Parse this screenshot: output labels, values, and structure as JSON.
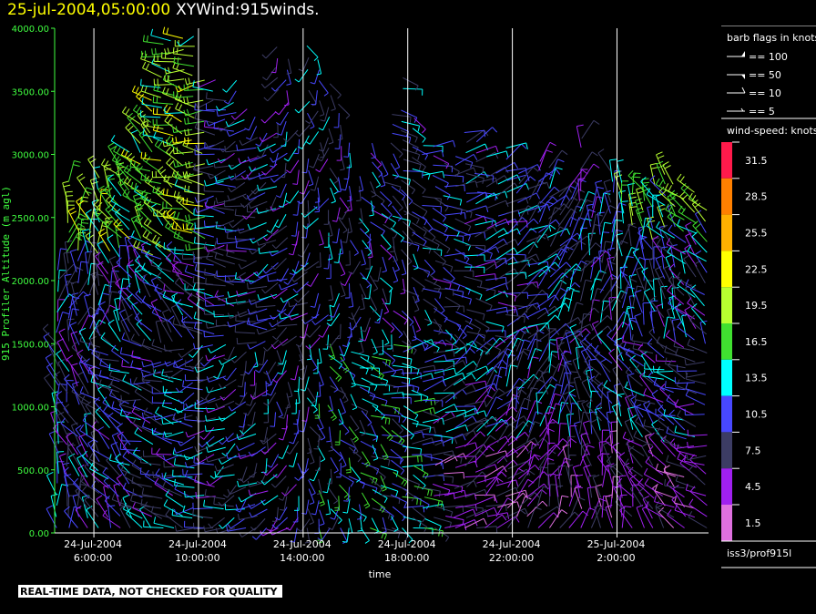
{
  "header": {
    "date": "25-jul-2004,05:00:00",
    "name": "XYWind:915winds."
  },
  "footer": {
    "notice": "REAL-TIME DATA, NOT CHECKED FOR QUALITY",
    "station": "iss3/prof915l"
  },
  "legend": {
    "barb_title": "barb flags in knots",
    "barbs": [
      {
        "label": "== 100",
        "speed": 100
      },
      {
        "label": "== 50",
        "speed": 50
      },
      {
        "label": "== 10",
        "speed": 10
      },
      {
        "label": "== 5",
        "speed": 5
      }
    ],
    "speed_title": "wind-speed: knots",
    "colorbar": [
      {
        "label": "31.5",
        "color": "#ff1a4b"
      },
      {
        "label": "28.5",
        "color": "#ff8000"
      },
      {
        "label": "25.5",
        "color": "#ffb000"
      },
      {
        "label": "22.5",
        "color": "#ffff00"
      },
      {
        "label": "19.5",
        "color": "#b8ff30"
      },
      {
        "label": "16.5",
        "color": "#40e030"
      },
      {
        "label": "13.5",
        "color": "#00ffff"
      },
      {
        "label": "10.5",
        "color": "#4848ff"
      },
      {
        "label": "7.5",
        "color": "#3c3c64"
      },
      {
        "label": "4.5",
        "color": "#a020f0"
      },
      {
        "label": "1.5",
        "color": "#e070e0"
      }
    ]
  },
  "chart_data": {
    "type": "scatter",
    "title": "XYWind:915winds.",
    "xlabel": "time",
    "ylabel": "915 Profiler Altitude (m agl)",
    "xlim_hours": [
      4.5,
      29.5
    ],
    "ylim": [
      0,
      4000
    ],
    "y_ticks": [
      "0.00",
      "500.00",
      "1000.00",
      "1500.00",
      "2000.00",
      "2500.00",
      "3000.00",
      "3500.00",
      "4000.00"
    ],
    "x_ticks": [
      {
        "hour": 6,
        "date": "24-Jul-2004",
        "time": "6:00:00"
      },
      {
        "hour": 10,
        "date": "24-Jul-2004",
        "time": "10:00:00"
      },
      {
        "hour": 14,
        "date": "24-Jul-2004",
        "time": "14:00:00"
      },
      {
        "hour": 18,
        "date": "24-Jul-2004",
        "time": "18:00:00"
      },
      {
        "hour": 22,
        "date": "24-Jul-2004",
        "time": "22:00:00"
      },
      {
        "hour": 26,
        "date": "25-Jul-2004",
        "time": "2:00:00"
      }
    ],
    "vertical_grid": true,
    "profiles": [
      {
        "t": 4.6,
        "top": 2100
      },
      {
        "t": 5.0,
        "top": 2800
      },
      {
        "t": 5.4,
        "top": 2600
      },
      {
        "t": 5.8,
        "top": 2700
      },
      {
        "t": 6.2,
        "top": 2900
      },
      {
        "t": 6.6,
        "top": 2800
      },
      {
        "t": 7.0,
        "top": 3000
      },
      {
        "t": 7.4,
        "top": 3100
      },
      {
        "t": 7.8,
        "top": 3300
      },
      {
        "t": 8.2,
        "top": 3500
      },
      {
        "t": 8.6,
        "top": 3900
      },
      {
        "t": 9.0,
        "top": 3950
      },
      {
        "t": 9.4,
        "top": 3950
      },
      {
        "t": 9.8,
        "top": 3950
      },
      {
        "t": 10.2,
        "top": 3700
      },
      {
        "t": 10.6,
        "top": 3600
      },
      {
        "t": 11.0,
        "top": 3500
      },
      {
        "t": 11.4,
        "top": 3650
      },
      {
        "t": 11.8,
        "top": 3400
      },
      {
        "t": 12.2,
        "top": 3300
      },
      {
        "t": 12.6,
        "top": 3200
      },
      {
        "t": 13.0,
        "top": 3900
      },
      {
        "t": 13.4,
        "top": 3800
      },
      {
        "t": 13.8,
        "top": 3200
      },
      {
        "t": 14.2,
        "top": 3900
      },
      {
        "t": 14.6,
        "top": 3800
      },
      {
        "t": 15.0,
        "top": 3600
      },
      {
        "t": 15.4,
        "top": 3400
      },
      {
        "t": 15.8,
        "top": 3100
      },
      {
        "t": 16.2,
        "top": 2900
      },
      {
        "t": 16.6,
        "top": 3100
      },
      {
        "t": 17.0,
        "top": 3000
      },
      {
        "t": 17.4,
        "top": 3400
      },
      {
        "t": 17.8,
        "top": 3700
      },
      {
        "t": 18.2,
        "top": 3300
      },
      {
        "t": 18.6,
        "top": 3200
      },
      {
        "t": 19.0,
        "top": 3100
      },
      {
        "t": 19.4,
        "top": 3000
      },
      {
        "t": 19.8,
        "top": 3100
      },
      {
        "t": 20.2,
        "top": 3200
      },
      {
        "t": 20.6,
        "top": 3100
      },
      {
        "t": 21.0,
        "top": 3000
      },
      {
        "t": 21.4,
        "top": 2950
      },
      {
        "t": 21.8,
        "top": 3100
      },
      {
        "t": 22.2,
        "top": 2900
      },
      {
        "t": 22.6,
        "top": 2800
      },
      {
        "t": 23.0,
        "top": 3000
      },
      {
        "t": 23.4,
        "top": 2900
      },
      {
        "t": 23.8,
        "top": 2700
      },
      {
        "t": 24.2,
        "top": 2800
      },
      {
        "t": 24.6,
        "top": 3200
      },
      {
        "t": 25.0,
        "top": 2600
      },
      {
        "t": 25.4,
        "top": 2700
      },
      {
        "t": 25.8,
        "top": 2900
      },
      {
        "t": 26.2,
        "top": 2800
      },
      {
        "t": 26.6,
        "top": 2700
      },
      {
        "t": 27.0,
        "top": 2750
      },
      {
        "t": 27.4,
        "top": 2800
      },
      {
        "t": 27.8,
        "top": 2850
      },
      {
        "t": 28.2,
        "top": 2800
      },
      {
        "t": 28.6,
        "top": 2700
      },
      {
        "t": 29.0,
        "top": 2700
      },
      {
        "t": 29.4,
        "top": 2650
      }
    ]
  }
}
